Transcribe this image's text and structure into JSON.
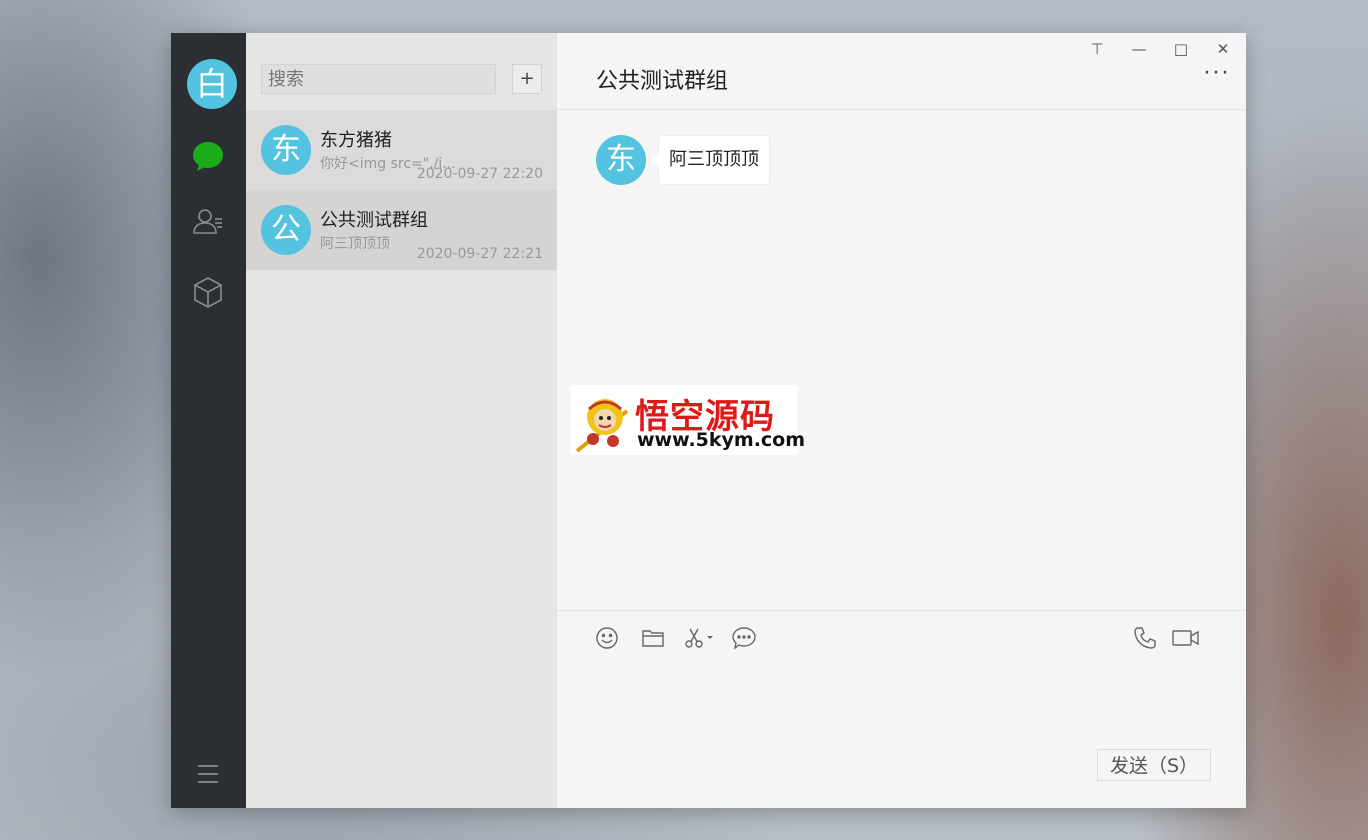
{
  "navbar": {
    "avatar_char": "白",
    "items": [
      {
        "name": "chat",
        "icon": "chat-bubble-icon",
        "active": true
      },
      {
        "name": "contacts",
        "icon": "contacts-icon",
        "active": false
      },
      {
        "name": "apps",
        "icon": "cube-icon",
        "active": false
      }
    ],
    "menu_icon": "hamburger-menu-icon"
  },
  "search": {
    "placeholder": "搜索",
    "add_label": "+"
  },
  "sessions": [
    {
      "avatar_char": "东",
      "name": "东方猪猪",
      "preview": "你好<img src=\"./i...",
      "time": "2020-09-27 22:20"
    },
    {
      "avatar_char": "公",
      "name": "公共测试群组",
      "preview": "阿三顶顶顶",
      "time": "2020-09-27 22:21"
    }
  ],
  "chat": {
    "title": "公共测试群组",
    "more_label": "···",
    "window_controls": {
      "pin": "⊤",
      "minimize": "—",
      "maximize": "□",
      "close": "✕"
    },
    "messages": [
      {
        "avatar_char": "东",
        "text": "阿三顶顶顶"
      }
    ],
    "toolbar": [
      "emoji-icon",
      "folder-icon",
      "scissors-icon",
      "chat-history-icon",
      "phone-icon",
      "video-icon"
    ],
    "send_label": "发送（S）"
  },
  "watermark": {
    "title": "悟空源码",
    "url": "www.5kym.com"
  },
  "colors": {
    "navbar_bg": "#2b2e33",
    "avatar": "#53c3df",
    "active_icon": "#1aad19",
    "session_bg": "#e6e5e5",
    "chat_bg": "#f5f5f5"
  }
}
